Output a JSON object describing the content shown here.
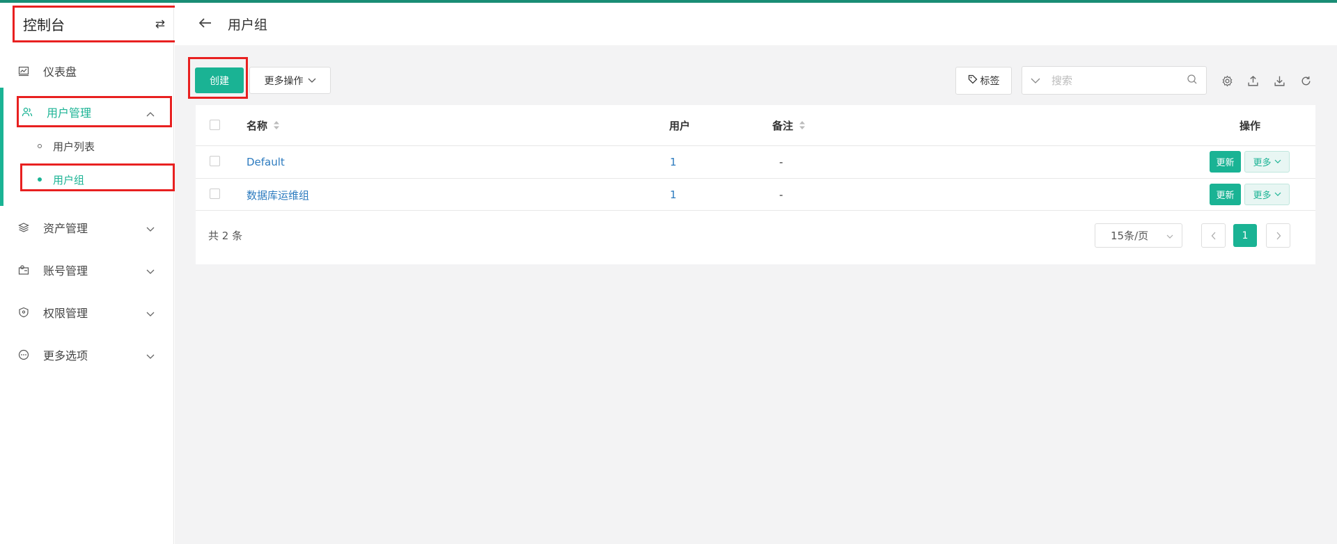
{
  "app": {
    "title": "控制台",
    "switch_icon": "⇄"
  },
  "sidebar": {
    "items": [
      {
        "label": "仪表盘",
        "icon": "chart-icon"
      },
      {
        "label": "用户管理",
        "icon": "users-icon",
        "expanded": true,
        "children": [
          {
            "label": "用户列表"
          },
          {
            "label": "用户组",
            "active": true
          }
        ]
      },
      {
        "label": "资产管理",
        "icon": "layers-icon"
      },
      {
        "label": "账号管理",
        "icon": "account-icon"
      },
      {
        "label": "权限管理",
        "icon": "shield-icon"
      },
      {
        "label": "更多选项",
        "icon": "more-icon"
      }
    ]
  },
  "header": {
    "title": "用户组"
  },
  "toolbar": {
    "create_label": "创建",
    "more_actions_label": "更多操作",
    "tags_label": "标签",
    "search_placeholder": "搜索"
  },
  "table": {
    "headers": {
      "name": "名称",
      "users": "用户",
      "comment": "备注",
      "actions": "操作"
    },
    "rows": [
      {
        "name": "Default",
        "users": "1",
        "comment": "-",
        "update": "更新",
        "more": "更多"
      },
      {
        "name": "数据库运维组",
        "users": "1",
        "comment": "-",
        "update": "更新",
        "more": "更多"
      }
    ]
  },
  "pagination": {
    "total_text": "共 2 条",
    "page_size": "15条/页",
    "current_page": "1"
  },
  "colors": {
    "accent": "#1ab394",
    "link": "#2d7bbf",
    "highlight_box": "#e82020"
  }
}
